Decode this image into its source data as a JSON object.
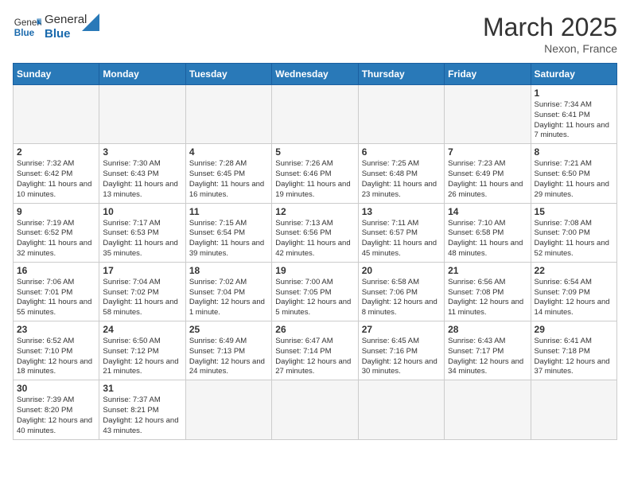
{
  "header": {
    "logo_general": "General",
    "logo_blue": "Blue",
    "month_title": "March 2025",
    "location": "Nexon, France"
  },
  "days_of_week": [
    "Sunday",
    "Monday",
    "Tuesday",
    "Wednesday",
    "Thursday",
    "Friday",
    "Saturday"
  ],
  "weeks": [
    [
      {
        "day": "",
        "info": ""
      },
      {
        "day": "",
        "info": ""
      },
      {
        "day": "",
        "info": ""
      },
      {
        "day": "",
        "info": ""
      },
      {
        "day": "",
        "info": ""
      },
      {
        "day": "",
        "info": ""
      },
      {
        "day": "1",
        "info": "Sunrise: 7:34 AM\nSunset: 6:41 PM\nDaylight: 11 hours and 7 minutes."
      }
    ],
    [
      {
        "day": "2",
        "info": "Sunrise: 7:32 AM\nSunset: 6:42 PM\nDaylight: 11 hours and 10 minutes."
      },
      {
        "day": "3",
        "info": "Sunrise: 7:30 AM\nSunset: 6:43 PM\nDaylight: 11 hours and 13 minutes."
      },
      {
        "day": "4",
        "info": "Sunrise: 7:28 AM\nSunset: 6:45 PM\nDaylight: 11 hours and 16 minutes."
      },
      {
        "day": "5",
        "info": "Sunrise: 7:26 AM\nSunset: 6:46 PM\nDaylight: 11 hours and 19 minutes."
      },
      {
        "day": "6",
        "info": "Sunrise: 7:25 AM\nSunset: 6:48 PM\nDaylight: 11 hours and 23 minutes."
      },
      {
        "day": "7",
        "info": "Sunrise: 7:23 AM\nSunset: 6:49 PM\nDaylight: 11 hours and 26 minutes."
      },
      {
        "day": "8",
        "info": "Sunrise: 7:21 AM\nSunset: 6:50 PM\nDaylight: 11 hours and 29 minutes."
      }
    ],
    [
      {
        "day": "9",
        "info": "Sunrise: 7:19 AM\nSunset: 6:52 PM\nDaylight: 11 hours and 32 minutes."
      },
      {
        "day": "10",
        "info": "Sunrise: 7:17 AM\nSunset: 6:53 PM\nDaylight: 11 hours and 35 minutes."
      },
      {
        "day": "11",
        "info": "Sunrise: 7:15 AM\nSunset: 6:54 PM\nDaylight: 11 hours and 39 minutes."
      },
      {
        "day": "12",
        "info": "Sunrise: 7:13 AM\nSunset: 6:56 PM\nDaylight: 11 hours and 42 minutes."
      },
      {
        "day": "13",
        "info": "Sunrise: 7:11 AM\nSunset: 6:57 PM\nDaylight: 11 hours and 45 minutes."
      },
      {
        "day": "14",
        "info": "Sunrise: 7:10 AM\nSunset: 6:58 PM\nDaylight: 11 hours and 48 minutes."
      },
      {
        "day": "15",
        "info": "Sunrise: 7:08 AM\nSunset: 7:00 PM\nDaylight: 11 hours and 52 minutes."
      }
    ],
    [
      {
        "day": "16",
        "info": "Sunrise: 7:06 AM\nSunset: 7:01 PM\nDaylight: 11 hours and 55 minutes."
      },
      {
        "day": "17",
        "info": "Sunrise: 7:04 AM\nSunset: 7:02 PM\nDaylight: 11 hours and 58 minutes."
      },
      {
        "day": "18",
        "info": "Sunrise: 7:02 AM\nSunset: 7:04 PM\nDaylight: 12 hours and 1 minute."
      },
      {
        "day": "19",
        "info": "Sunrise: 7:00 AM\nSunset: 7:05 PM\nDaylight: 12 hours and 5 minutes."
      },
      {
        "day": "20",
        "info": "Sunrise: 6:58 AM\nSunset: 7:06 PM\nDaylight: 12 hours and 8 minutes."
      },
      {
        "day": "21",
        "info": "Sunrise: 6:56 AM\nSunset: 7:08 PM\nDaylight: 12 hours and 11 minutes."
      },
      {
        "day": "22",
        "info": "Sunrise: 6:54 AM\nSunset: 7:09 PM\nDaylight: 12 hours and 14 minutes."
      }
    ],
    [
      {
        "day": "23",
        "info": "Sunrise: 6:52 AM\nSunset: 7:10 PM\nDaylight: 12 hours and 18 minutes."
      },
      {
        "day": "24",
        "info": "Sunrise: 6:50 AM\nSunset: 7:12 PM\nDaylight: 12 hours and 21 minutes."
      },
      {
        "day": "25",
        "info": "Sunrise: 6:49 AM\nSunset: 7:13 PM\nDaylight: 12 hours and 24 minutes."
      },
      {
        "day": "26",
        "info": "Sunrise: 6:47 AM\nSunset: 7:14 PM\nDaylight: 12 hours and 27 minutes."
      },
      {
        "day": "27",
        "info": "Sunrise: 6:45 AM\nSunset: 7:16 PM\nDaylight: 12 hours and 30 minutes."
      },
      {
        "day": "28",
        "info": "Sunrise: 6:43 AM\nSunset: 7:17 PM\nDaylight: 12 hours and 34 minutes."
      },
      {
        "day": "29",
        "info": "Sunrise: 6:41 AM\nSunset: 7:18 PM\nDaylight: 12 hours and 37 minutes."
      }
    ],
    [
      {
        "day": "30",
        "info": "Sunrise: 7:39 AM\nSunset: 8:20 PM\nDaylight: 12 hours and 40 minutes."
      },
      {
        "day": "31",
        "info": "Sunrise: 7:37 AM\nSunset: 8:21 PM\nDaylight: 12 hours and 43 minutes."
      },
      {
        "day": "",
        "info": ""
      },
      {
        "day": "",
        "info": ""
      },
      {
        "day": "",
        "info": ""
      },
      {
        "day": "",
        "info": ""
      },
      {
        "day": "",
        "info": ""
      }
    ]
  ]
}
